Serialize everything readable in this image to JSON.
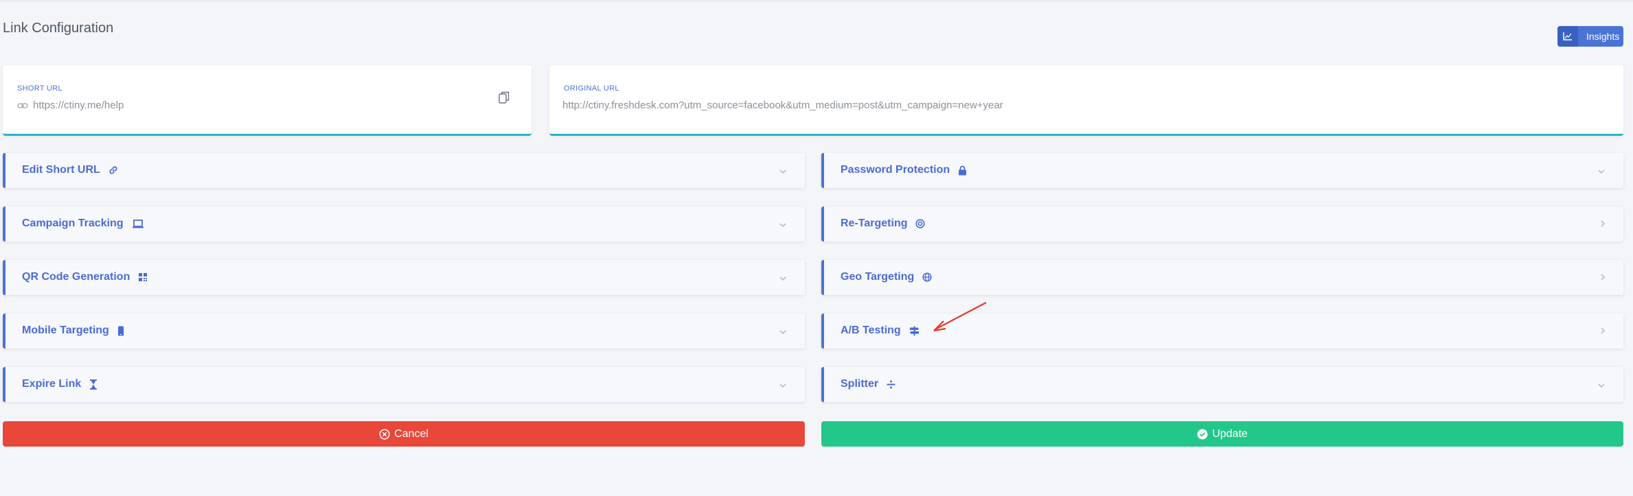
{
  "page": {
    "title": "Link Configuration"
  },
  "header": {
    "insights_label": "Insights"
  },
  "short_url": {
    "caption": "SHORT URL",
    "value": "https://ctiny.me/help"
  },
  "original_url": {
    "caption": "ORIGINAL URL",
    "value": "http://ctiny.freshdesk.com?utm_source=facebook&utm_medium=post&utm_campaign=new+year"
  },
  "left_panels": [
    {
      "label": "Edit Short URL",
      "icon": "link-icon"
    },
    {
      "label": "Campaign Tracking",
      "icon": "laptop-icon"
    },
    {
      "label": "QR Code Generation",
      "icon": "qrcode-icon"
    },
    {
      "label": "Mobile Targeting",
      "icon": "mobile-icon"
    },
    {
      "label": "Expire Link",
      "icon": "hourglass-icon"
    }
  ],
  "right_panels": [
    {
      "label": "Password Protection",
      "icon": "lock-icon"
    },
    {
      "label": "Re-Targeting",
      "icon": "target-icon"
    },
    {
      "label": "Geo Targeting",
      "icon": "globe-icon"
    },
    {
      "label": "A/B Testing",
      "icon": "signpost-icon"
    },
    {
      "label": "Splitter",
      "icon": "divide-icon"
    }
  ],
  "actions": {
    "cancel_label": "Cancel",
    "update_label": "Update"
  },
  "colors": {
    "accent": "#4a73d6",
    "cancel": "#e8473a",
    "update": "#24c78a",
    "card_border": "#25b4c8",
    "arrow": "#e8392a"
  }
}
